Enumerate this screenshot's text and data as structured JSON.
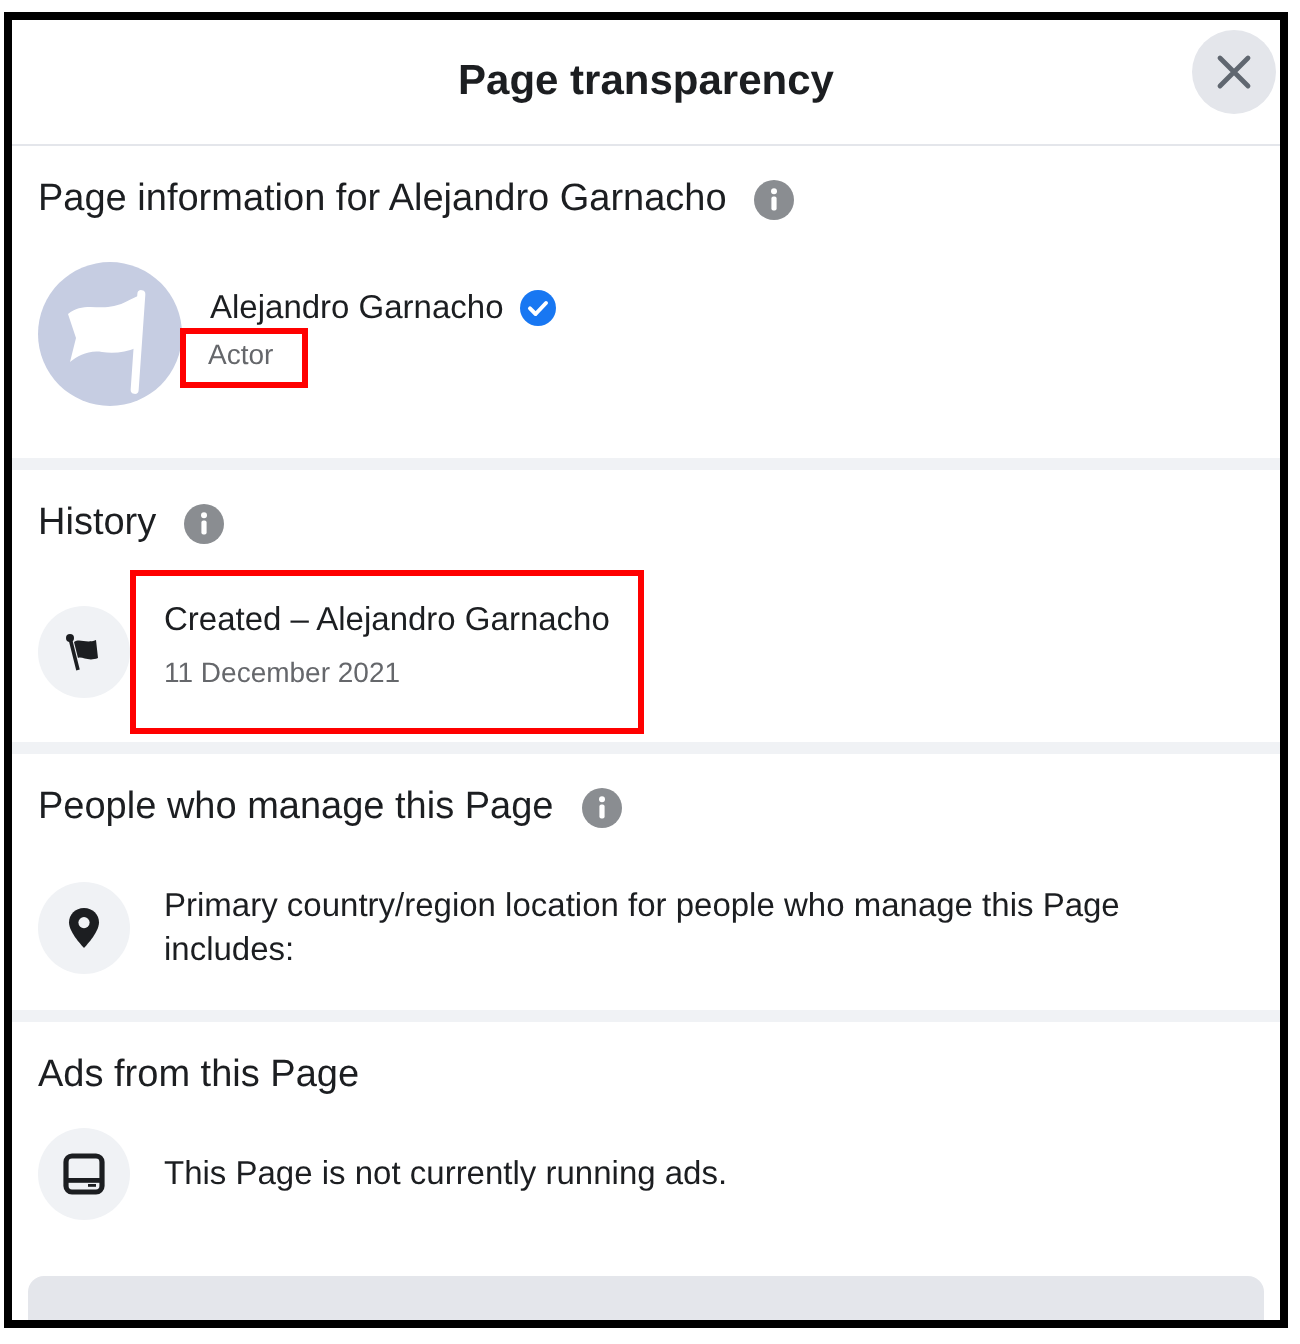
{
  "dialog": {
    "title": "Page transparency"
  },
  "sections": [
    {
      "kind": "profile",
      "title": "Page information for Alejandro Garnacho",
      "info": true,
      "name": "Alejandro Garnacho",
      "verified": true,
      "role": "Actor",
      "role_highlighted": true
    },
    {
      "kind": "list",
      "title": "History",
      "info": true,
      "items": [
        {
          "kind": "flag",
          "text": "Created – Alejandro Garnacho",
          "detail": "11 December 2021",
          "highlighted": true
        }
      ]
    },
    {
      "kind": "list",
      "title": "People who manage this Page",
      "info": true,
      "items": [
        {
          "kind": "pin",
          "text": "Primary country/region location for people who manage this Page includes:",
          "highlighted": false
        }
      ]
    },
    {
      "kind": "list",
      "title": "Ads from this Page",
      "items": [
        {
          "kind": "ads",
          "text": "This Page is not currently running ads.",
          "highlighted": false
        }
      ]
    }
  ]
}
